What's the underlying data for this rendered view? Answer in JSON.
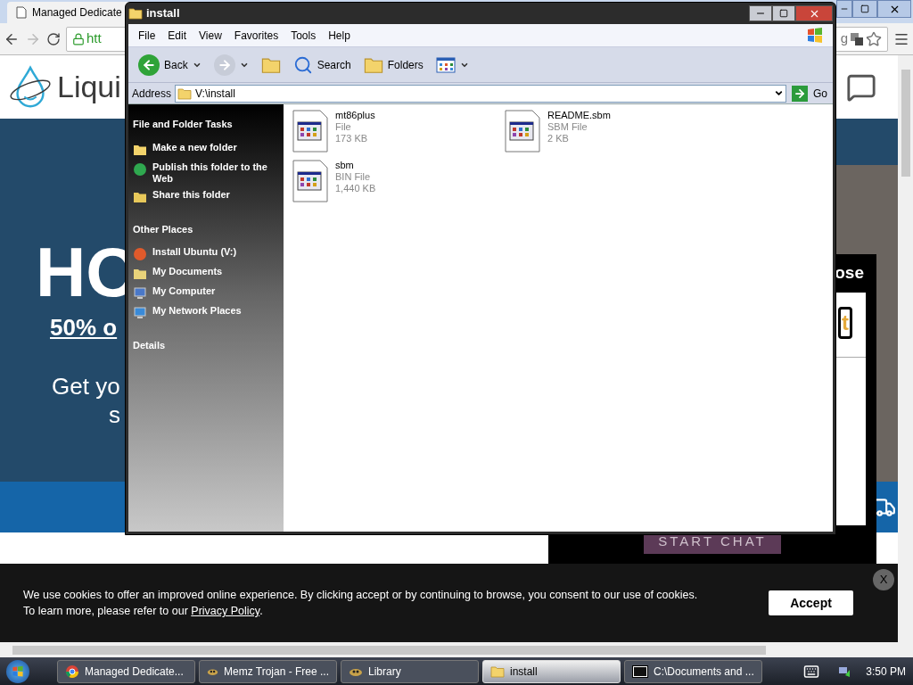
{
  "browser": {
    "tab_title": "Managed Dedicate",
    "url": "htt",
    "url_tail": "g",
    "page": {
      "logo_text": "Liqui",
      "hero_title": "HO",
      "hero_offer": "50% o",
      "hero_lines": [
        "Get yo",
        "s"
      ]
    },
    "chat_widget": {
      "heading": "ose",
      "button_fragment": "t",
      "start_button": "START CHAT"
    }
  },
  "cookie_banner": {
    "text": "We use cookies to offer an improved online experience. By clicking accept or by continuing to browse, you consent to our use of cookies.",
    "text_2": "To learn more, please refer to our ",
    "link": "Privacy Policy",
    "text_2_end": ".",
    "accept": "Accept",
    "close": "X"
  },
  "explorer": {
    "title": "install",
    "menu": [
      "File",
      "Edit",
      "View",
      "Favorites",
      "Tools",
      "Help"
    ],
    "toolbar": [
      {
        "kind": "back",
        "label": "Back",
        "disabled": false
      },
      {
        "kind": "forward",
        "disabled": true
      },
      {
        "kind": "up"
      },
      {
        "kind": "search",
        "label": "Search"
      },
      {
        "kind": "folders",
        "label": "Folders"
      },
      {
        "kind": "views"
      }
    ],
    "address_label": "Address",
    "address": "V:\\install",
    "go": "Go",
    "sidebar": [
      {
        "heading": "File and Folder Tasks",
        "items": [
          {
            "kind": "new-folder",
            "label": "Make a new folder"
          },
          {
            "kind": "web",
            "label": "Publish this folder to the Web"
          },
          {
            "kind": "share",
            "label": "Share this folder"
          }
        ]
      },
      {
        "heading": "Other Places",
        "items": [
          {
            "kind": "drive",
            "label": "Install Ubuntu (V:)"
          },
          {
            "kind": "documents",
            "label": "My Documents"
          },
          {
            "kind": "computer",
            "label": "My Computer"
          },
          {
            "kind": "network",
            "label": "My Network Places"
          }
        ]
      },
      {
        "heading": "Details"
      }
    ],
    "files": [
      {
        "name": "mt86plus",
        "type": "File",
        "size": "173 KB"
      },
      {
        "name": "README.sbm",
        "type": "SBM File",
        "size": "2 KB"
      },
      {
        "name": "sbm",
        "type": "BIN File",
        "size": "1,440 KB"
      }
    ]
  },
  "taskbar": {
    "items": [
      {
        "kind": "browser",
        "label": "Managed Dedicate...",
        "selected": false
      },
      {
        "kind": "app",
        "label": "Memz Trojan - Free ...",
        "selected": false
      },
      {
        "kind": "app",
        "label": "Library",
        "selected": false
      },
      {
        "kind": "folder",
        "label": "install",
        "selected": true
      },
      {
        "kind": "console",
        "label": "C:\\Documents and ...",
        "selected": false
      }
    ],
    "clock": "3:50 PM"
  }
}
